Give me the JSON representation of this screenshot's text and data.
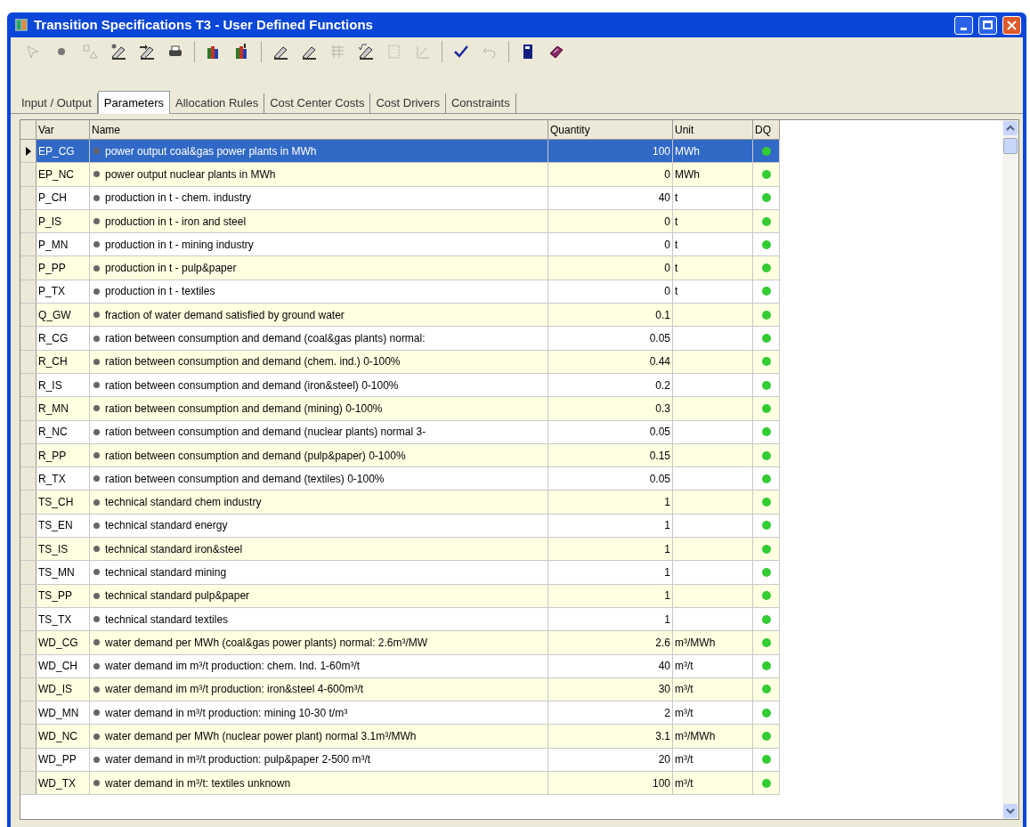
{
  "window": {
    "title": "Transition Specifications T3 - User Defined Functions"
  },
  "toolbar_groups": [
    [
      {
        "kind": "pointer",
        "disabled": true
      },
      {
        "kind": "dot",
        "disabled": false
      },
      {
        "kind": "shapes",
        "disabled": true
      },
      {
        "kind": "pen-dot",
        "disabled": false
      },
      {
        "kind": "pen-arrow",
        "disabled": false
      },
      {
        "kind": "printer",
        "disabled": false
      }
    ],
    [
      {
        "kind": "books",
        "disabled": false
      },
      {
        "kind": "books-arrow",
        "disabled": false
      }
    ],
    [
      {
        "kind": "pen",
        "disabled": false
      },
      {
        "kind": "pen",
        "disabled": false
      },
      {
        "kind": "grid",
        "disabled": true
      },
      {
        "kind": "pen-root",
        "disabled": false
      },
      {
        "kind": "frame",
        "disabled": true
      },
      {
        "kind": "chart",
        "disabled": true
      }
    ],
    [
      {
        "kind": "check",
        "disabled": false
      },
      {
        "kind": "undo",
        "disabled": true
      }
    ],
    [
      {
        "kind": "door",
        "disabled": false
      },
      {
        "kind": "book",
        "disabled": false
      }
    ]
  ],
  "tabs": [
    {
      "label": "Input / Output",
      "selected": false
    },
    {
      "label": "Parameters",
      "selected": true
    },
    {
      "label": "Allocation Rules",
      "selected": false
    },
    {
      "label": "Cost Center Costs",
      "selected": false
    },
    {
      "label": "Cost Drivers",
      "selected": false
    },
    {
      "label": "Constraints",
      "selected": false
    }
  ],
  "table": {
    "columns": [
      "Var",
      "Name",
      "Quantity",
      "Unit",
      "DQ"
    ],
    "rows": [
      {
        "var": "EP_CG",
        "name": "power output coal&gas power plants in MWh",
        "quantity": "100",
        "unit": "MWh",
        "selected": true,
        "color": "#33cc33"
      },
      {
        "var": "EP_NC",
        "name": "power output nuclear plants in MWh",
        "quantity": "0",
        "unit": "MWh",
        "selected": false,
        "color": "#33cc33"
      },
      {
        "var": "P_CH",
        "name": "production in t - chem. industry",
        "quantity": "40",
        "unit": "t",
        "selected": false,
        "color": "#33cc33"
      },
      {
        "var": "P_IS",
        "name": "production in t - iron and steel",
        "quantity": "0",
        "unit": "t",
        "selected": false,
        "color": "#33cc33"
      },
      {
        "var": "P_MN",
        "name": "production in t - mining industry",
        "quantity": "0",
        "unit": "t",
        "selected": false,
        "color": "#33cc33"
      },
      {
        "var": "P_PP",
        "name": "production in t - pulp&paper",
        "quantity": "0",
        "unit": "t",
        "selected": false,
        "color": "#33cc33"
      },
      {
        "var": "P_TX",
        "name": "production in t - textiles",
        "quantity": "0",
        "unit": "t",
        "selected": false,
        "color": "#33cc33"
      },
      {
        "var": "Q_GW",
        "name": "fraction of water demand satisfied by ground water",
        "quantity": "0.1",
        "selected": false,
        "color": "#33cc33"
      },
      {
        "var": "R_CG",
        "name": "ration between consumption and demand (coal&gas plants) normal:",
        "quantity": "0.05",
        "selected": false,
        "color": "#33cc33"
      },
      {
        "var": "R_CH",
        "name": "ration between consumption and demand (chem. ind.) 0-100%",
        "quantity": "0.44",
        "selected": false,
        "color": "#33cc33"
      },
      {
        "var": "R_IS",
        "name": "ration between consumption and demand (iron&steel) 0-100%",
        "quantity": "0.2",
        "selected": false,
        "color": "#33cc33"
      },
      {
        "var": "R_MN",
        "name": "ration between consumption and demand (mining) 0-100%",
        "quantity": "0.3",
        "selected": false,
        "color": "#33cc33"
      },
      {
        "var": "R_NC",
        "name": "ration between consumption and demand (nuclear plants) normal 3-",
        "quantity": "0.05",
        "selected": false,
        "color": "#33cc33"
      },
      {
        "var": "R_PP",
        "name": "ration between consumption and demand (pulp&paper) 0-100%",
        "quantity": "0.15",
        "selected": false,
        "color": "#33cc33"
      },
      {
        "var": "R_TX",
        "name": "ration between consumption and demand (textiles) 0-100%",
        "quantity": "0.05",
        "selected": false,
        "color": "#33cc33"
      },
      {
        "var": "TS_CH",
        "name": "technical standard chem industry",
        "quantity": "1",
        "selected": false,
        "color": "#33cc33"
      },
      {
        "var": "TS_EN",
        "name": "technical standard energy",
        "quantity": "1",
        "selected": false,
        "color": "#33cc33"
      },
      {
        "var": "TS_IS",
        "name": "technical standard iron&steel",
        "quantity": "1",
        "selected": false,
        "color": "#33cc33"
      },
      {
        "var": "TS_MN",
        "name": "technical standard mining",
        "quantity": "1",
        "selected": false,
        "color": "#33cc33"
      },
      {
        "var": "TS_PP",
        "name": "technical standard pulp&paper",
        "quantity": "1",
        "selected": false,
        "color": "#33cc33"
      },
      {
        "var": "TS_TX",
        "name": "technical standard textiles",
        "quantity": "1",
        "selected": false,
        "color": "#33cc33"
      },
      {
        "var": "WD_CG",
        "name": "water demand per MWh (coal&gas power plants) normal: 2.6m³/MW",
        "quantity": "2.6",
        "unit": "m³/MWh",
        "selected": false,
        "color": "#33cc33"
      },
      {
        "var": "WD_CH",
        "name": "water demand im m³/t production: chem. Ind. 1-60m³/t",
        "quantity": "40",
        "unit": "m³/t",
        "selected": false,
        "color": "#33cc33"
      },
      {
        "var": "WD_IS",
        "name": "water demand im m³/t production: iron&steel  4-600m³/t",
        "quantity": "30",
        "unit": "m³/t",
        "selected": false,
        "color": "#33cc33"
      },
      {
        "var": "WD_MN",
        "name": "water demand in m³/t production: mining 10-30 t/m³",
        "quantity": "2",
        "unit": "m³/t",
        "selected": false,
        "color": "#33cc33"
      },
      {
        "var": "WD_NC",
        "name": "water demand per MWh (nuclear power plant) normal 3.1m³/MWh",
        "quantity": "3.1",
        "unit": "m³/MWh",
        "selected": false,
        "color": "#33cc33"
      },
      {
        "var": "WD_PP",
        "name": "water demand in m³/t production: pulp&paper 2-500 m³/t",
        "quantity": "20",
        "unit": "m³/t",
        "selected": false,
        "color": "#33cc33"
      },
      {
        "var": "WD_TX",
        "name": "water demand in m³/t: textiles unknown",
        "quantity": "100",
        "unit": "m³/t",
        "selected": false,
        "color": "#33cc33"
      }
    ]
  }
}
